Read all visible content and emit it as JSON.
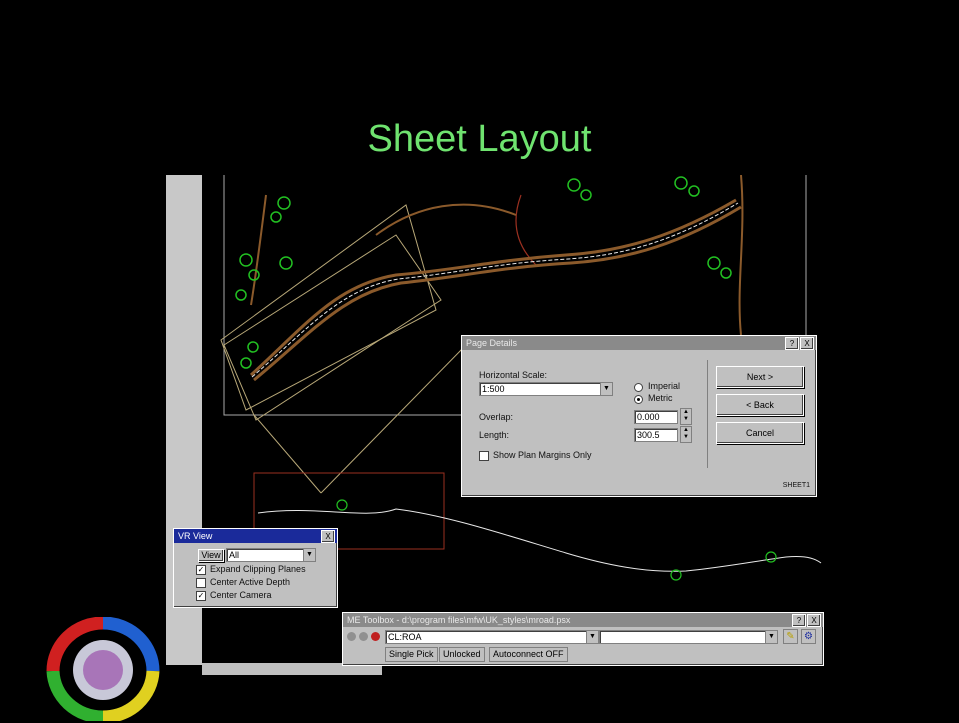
{
  "slide": {
    "title": "Sheet Layout"
  },
  "page_details": {
    "title": "Page Details",
    "help": "?",
    "close": "X",
    "horizontal_scale_label": "Horizontal Scale:",
    "horizontal_scale_value": "1:500",
    "units_options": [
      "Imperial",
      "Metric"
    ],
    "units_selected": "Metric",
    "overlap_label": "Overlap:",
    "overlap_value": "0.000",
    "length_label": "Length:",
    "length_value": "300.5",
    "show_plan_margins_label": "Show Plan Margins Only",
    "show_plan_margins_checked": false,
    "next_label": "Next >",
    "back_label": "< Back",
    "cancel_label": "Cancel",
    "status_code": "SHEET1"
  },
  "vr_view": {
    "title": "VR View",
    "close": "X",
    "view_label": "View",
    "view_value": "All",
    "options": [
      {
        "label": "Expand Clipping Planes",
        "checked": true
      },
      {
        "label": "Center Active Depth",
        "checked": false
      },
      {
        "label": "Center Camera",
        "checked": true
      }
    ]
  },
  "toolbox": {
    "title": "ME Toolbox - d:\\program files\\mfw\\UK_styles\\mroad.psx",
    "help": "?",
    "close": "X",
    "selector_value": "CL:ROA",
    "status_items": [
      "Single Pick",
      "Unlocked",
      "Autoconnect OFF"
    ]
  },
  "colors": {
    "title_green": "#6fe36f",
    "road_brown": "#8b5a2b",
    "tree_green": "#22c022",
    "outline_tan": "#b8a878",
    "outline_red": "#9a3020"
  },
  "icons": [
    "minimize-icon",
    "help-icon",
    "close-icon",
    "dropdown-arrow-icon",
    "lock-icon",
    "tool-icon",
    "logo-icon"
  ]
}
